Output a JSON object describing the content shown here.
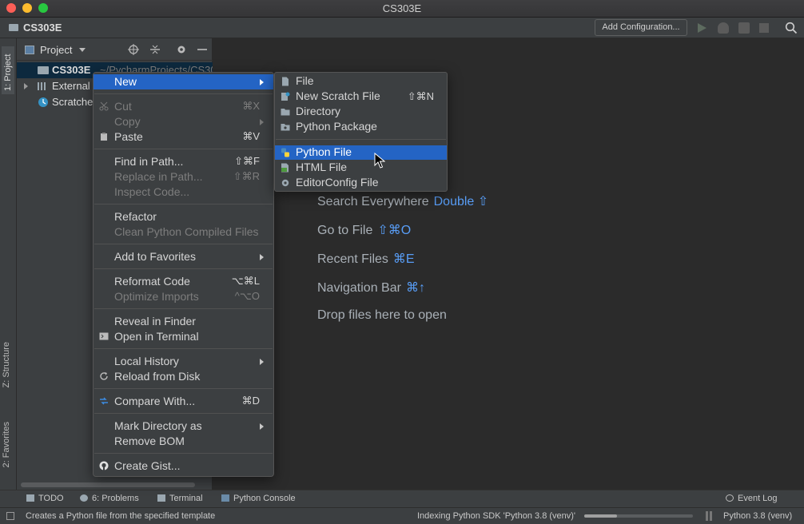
{
  "window": {
    "title": "CS303E"
  },
  "navbar": {
    "project_name": "CS303E",
    "add_configuration": "Add Configuration..."
  },
  "side_tabs": {
    "project": "1: Project",
    "structure": "Z: Structure",
    "favorites": "2: Favorites"
  },
  "project_panel": {
    "title": "Project",
    "tree": [
      {
        "label": "CS303E",
        "path": "~/PycharmProjects/CS30"
      },
      {
        "label": "External"
      },
      {
        "label": "Scratche"
      }
    ]
  },
  "editor_hints": [
    {
      "label": "Search Everywhere",
      "shortcut": "Double ⇧"
    },
    {
      "label": "Go to File",
      "shortcut": "⇧⌘O"
    },
    {
      "label": "Recent Files",
      "shortcut": "⌘E"
    },
    {
      "label": "Navigation Bar",
      "shortcut": "⌘↑"
    },
    {
      "label": "Drop files here to open",
      "shortcut": ""
    }
  ],
  "context_menu": {
    "new": "New",
    "cut": {
      "label": "Cut",
      "shortcut": "⌘X"
    },
    "copy": "Copy",
    "paste": {
      "label": "Paste",
      "shortcut": "⌘V"
    },
    "find_in_path": {
      "label": "Find in Path...",
      "shortcut": "⇧⌘F"
    },
    "replace_in_path": {
      "label": "Replace in Path...",
      "shortcut": "⇧⌘R"
    },
    "inspect_code": "Inspect Code...",
    "refactor": "Refactor",
    "clean_compiled": "Clean Python Compiled Files",
    "add_to_favorites": "Add to Favorites",
    "reformat_code": {
      "label": "Reformat Code",
      "shortcut": "⌥⌘L"
    },
    "optimize_imports": {
      "label": "Optimize Imports",
      "shortcut": "^⌥O"
    },
    "reveal_in_finder": "Reveal in Finder",
    "open_in_terminal": "Open in Terminal",
    "local_history": "Local History",
    "reload_from_disk": "Reload from Disk",
    "compare_with": {
      "label": "Compare With...",
      "shortcut": "⌘D"
    },
    "mark_directory_as": "Mark Directory as",
    "remove_bom": "Remove BOM",
    "create_gist": "Create Gist..."
  },
  "new_submenu": {
    "file": "File",
    "new_scratch_file": {
      "label": "New Scratch File",
      "shortcut": "⇧⌘N"
    },
    "directory": "Directory",
    "python_package": "Python Package",
    "python_file": "Python File",
    "html_file": "HTML File",
    "editorconfig_file": "EditorConfig File"
  },
  "bottom_tools": {
    "todo": "TODO",
    "problems": "6: Problems",
    "terminal": "Terminal",
    "python_console": "Python Console",
    "event_log": "Event Log"
  },
  "status_bar": {
    "message": "Creates a Python file from the specified template",
    "indexing": "Indexing Python SDK 'Python 3.8 (venv)'",
    "progress": 0.3,
    "interpreter": "Python 3.8 (venv)"
  },
  "colors": {
    "selection": "#2464c4",
    "hint_key": "#589df6",
    "background": "#2b2b2b",
    "panel": "#3c3f41"
  }
}
